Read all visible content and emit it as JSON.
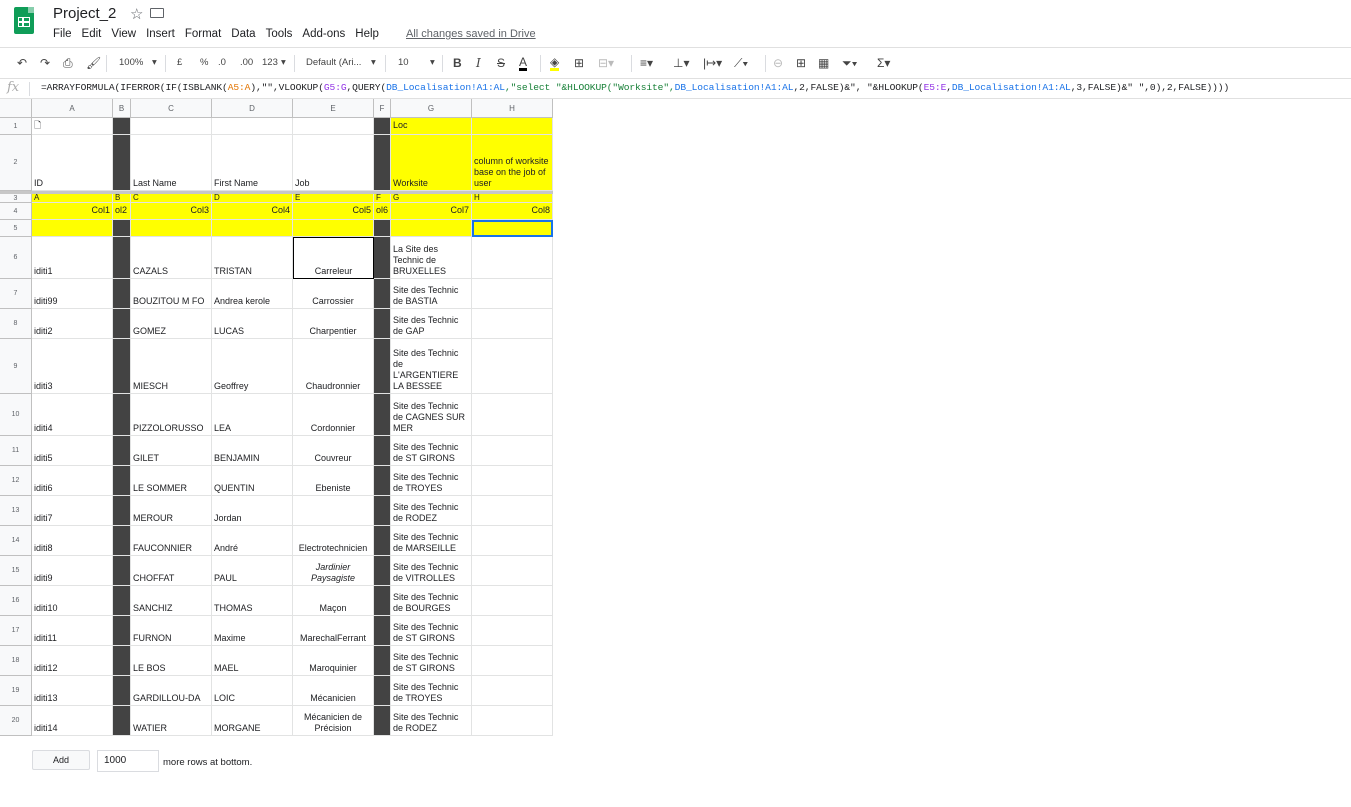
{
  "app": {
    "title": "Project_2",
    "save_status": "All changes saved in Drive"
  },
  "menu": [
    "File",
    "Edit",
    "View",
    "Insert",
    "Format",
    "Data",
    "Tools",
    "Add-ons",
    "Help"
  ],
  "toolbar": {
    "zoom": "100%",
    "currency": "£",
    "percent": "%",
    "dec_less": ".0",
    "dec_more": ".00",
    "format_more": "123",
    "font": "Default (Ari...",
    "font_size": "10",
    "bold": "B",
    "italic": "I",
    "strike": "S",
    "text_color": "A"
  },
  "formula": {
    "fx": "fx",
    "parts": [
      {
        "t": "=ARRAYFORMULA(IFERROR(IF(ISBLANK(",
        "c": ""
      },
      {
        "t": "A5:A",
        "c": "orange"
      },
      {
        "t": "),\"\",VLOOKUP(",
        "c": ""
      },
      {
        "t": "G5:G",
        "c": "purple"
      },
      {
        "t": ",QUERY(",
        "c": ""
      },
      {
        "t": "DB_Localisation!A1:AL",
        "c": "blue"
      },
      {
        "t": ",\"select \"&HLOOKUP(\"Worksite\",",
        "c": "green"
      },
      {
        "t": "DB_Localisation!A1:AL",
        "c": "blue"
      },
      {
        "t": ",2,FALSE)&\", \"&HLOOKUP(",
        "c": ""
      },
      {
        "t": "E5:E",
        "c": "purple"
      },
      {
        "t": ",",
        "c": ""
      },
      {
        "t": "DB_Localisation!A1:AL",
        "c": "blue"
      },
      {
        "t": ",3,FALSE)&\" \",0),2,FALSE))))",
        "c": ""
      }
    ]
  },
  "columns": [
    "A",
    "B",
    "C",
    "D",
    "E",
    "F",
    "G",
    "H"
  ],
  "header_rows": {
    "row1": {
      "A": "🗋",
      "G": "Loc"
    },
    "row2": {
      "A": "ID",
      "C": "Last Name",
      "D": "First Name",
      "E": "Job",
      "G": "Worksite",
      "H": "column of worksite base on the job of user"
    },
    "row3": {
      "A": "A",
      "B": "B",
      "C": "C",
      "D": "D",
      "E": "E",
      "F": "F",
      "G": "G",
      "H": "H"
    },
    "row4": {
      "A": "Col1",
      "B": "ol2",
      "C": "Col3",
      "D": "Col4",
      "E": "Col5",
      "F": "ol6",
      "G": "Col7",
      "H": "Col8"
    }
  },
  "rows": [
    {
      "n": "6",
      "id": "iditi1",
      "last": "CAZALS",
      "first": "TRISTAN",
      "job": "Carreleur",
      "site": "La Site des Technic de BRUXELLES"
    },
    {
      "n": "7",
      "id": "iditi99",
      "last": "BOUZITOU M FO",
      "first": "Andrea kerole",
      "job": "Carrossier",
      "site": "Site des Technic de  BASTIA"
    },
    {
      "n": "8",
      "id": "iditi2",
      "last": "GOMEZ",
      "first": "LUCAS",
      "job": "Charpentier",
      "site": "Site des Technic de  GAP"
    },
    {
      "n": "9",
      "id": "iditi3",
      "last": "MIESCH",
      "first": "Geoffrey",
      "job": "Chaudronnier",
      "site": "Site des Technic de L'ARGENTIERE LA BESSEE"
    },
    {
      "n": "10",
      "id": "iditi4",
      "last": "PIZZOLORUSSO",
      "first": "LEA",
      "job": "Cordonnier",
      "site": "Site des Technic de  CAGNES SUR MER"
    },
    {
      "n": "11",
      "id": "iditi5",
      "last": "GILET",
      "first": "BENJAMIN",
      "job": "Couvreur",
      "site": "Site des Technic de  ST GIRONS"
    },
    {
      "n": "12",
      "id": "iditi6",
      "last": "LE SOMMER",
      "first": "QUENTIN",
      "job": "Ebeniste",
      "site": "Site des Technic de  TROYES"
    },
    {
      "n": "13",
      "id": "iditi7",
      "last": "MEROUR",
      "first": "Jordan",
      "job": "",
      "site": "Site des Technic de  RODEZ"
    },
    {
      "n": "14",
      "id": "iditi8",
      "last": "FAUCONNIER",
      "first": "André",
      "job": "Electrotechnicien",
      "site": "Site des Technic de  MARSEILLE"
    },
    {
      "n": "15",
      "id": "iditi9",
      "last": "CHOFFAT",
      "first": "PAUL",
      "job": "Jardinier Paysagiste",
      "site": "Site des Technic de  VITROLLES"
    },
    {
      "n": "16",
      "id": "iditi10",
      "last": "SANCHIZ",
      "first": "THOMAS",
      "job": "Maçon",
      "site": "Site des Technic de  BOURGES"
    },
    {
      "n": "17",
      "id": "iditi11",
      "last": "FURNON",
      "first": "Maxime",
      "job": "MarechalFerrant",
      "site": "Site des Technic de  ST GIRONS"
    },
    {
      "n": "18",
      "id": "iditi12",
      "last": "LE BOS",
      "first": "MAEL",
      "job": "Maroquinier",
      "site": "Site des Technic de  ST GIRONS"
    },
    {
      "n": "19",
      "id": "iditi13",
      "last": "GARDILLOU-DA",
      "first": "LOIC",
      "job": "Mécanicien",
      "site": "Site des Technic de  TROYES"
    },
    {
      "n": "20",
      "id": "iditi14",
      "last": "WATIER",
      "first": "MORGANE",
      "job": "Mécanicien de Précision",
      "site": "Site des Technic de  RODEZ"
    }
  ],
  "header_row_numbers": [
    "1",
    "2",
    "3",
    "4",
    "5"
  ],
  "footer": {
    "add_label": "Add",
    "rows_value": "1000",
    "more_rows": "more rows at bottom."
  },
  "colors": {
    "yellow": "#ffff00",
    "dark_column": "#434343",
    "selection": "#1a73e8",
    "brand": "#0f9d58"
  }
}
